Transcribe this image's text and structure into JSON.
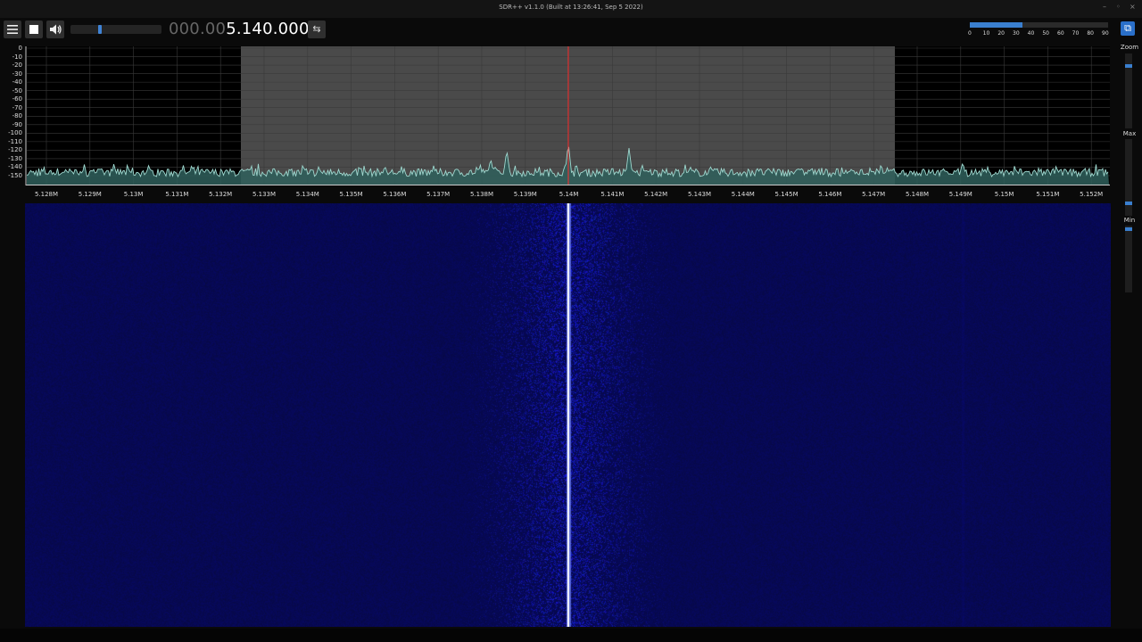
{
  "window": {
    "title": "SDR++ v1.1.0 (Built at 13:26:41, Sep  5 2022)",
    "minimize": "–",
    "maximize": "◦",
    "close": "×"
  },
  "toolbar": {
    "menu_icon": "menu-icon",
    "stop_icon": "stop-icon",
    "volume_icon": "speaker-icon",
    "volume_level": 0.32,
    "frequency_dim": "000.00",
    "frequency_bright": "5.140.000",
    "swap_icon": "⇆"
  },
  "snr_meter": {
    "ticks": [
      "0",
      "10",
      "20",
      "30",
      "40",
      "50",
      "60",
      "70",
      "80",
      "90"
    ],
    "level": 38
  },
  "fft": {
    "y_labels": [
      "0",
      "-10",
      "-20",
      "-30",
      "-40",
      "-50",
      "-60",
      "-70",
      "-80",
      "-90",
      "-100",
      "-110",
      "-120",
      "-130",
      "-140",
      "-150"
    ],
    "x_labels": [
      "5.128M",
      "5.129M",
      "5.13M",
      "5.131M",
      "5.132M",
      "5.133M",
      "5.134M",
      "5.135M",
      "5.136M",
      "5.137M",
      "5.138M",
      "5.139M",
      "5.14M",
      "5.141M",
      "5.142M",
      "5.143M",
      "5.144M",
      "5.145M",
      "5.146M",
      "5.147M",
      "5.148M",
      "5.149M",
      "5.15M",
      "5.151M",
      "5.152M"
    ],
    "center_frequency": "5.14M",
    "vfo_band": [
      "5.1325M",
      "5.1475M"
    ],
    "colors": {
      "trace": "#9fd8cf",
      "fill": "#2f5f5c",
      "center_line": "#ff3030",
      "vfo": "#5a5a5a"
    }
  },
  "waterfall": {
    "background": "#070747",
    "signal_color": "#ffffff"
  },
  "right_panel": {
    "zoom_label": "Zoom",
    "max_label": "Max",
    "min_label": "Min",
    "corner_icon": "display-settings-icon"
  }
}
